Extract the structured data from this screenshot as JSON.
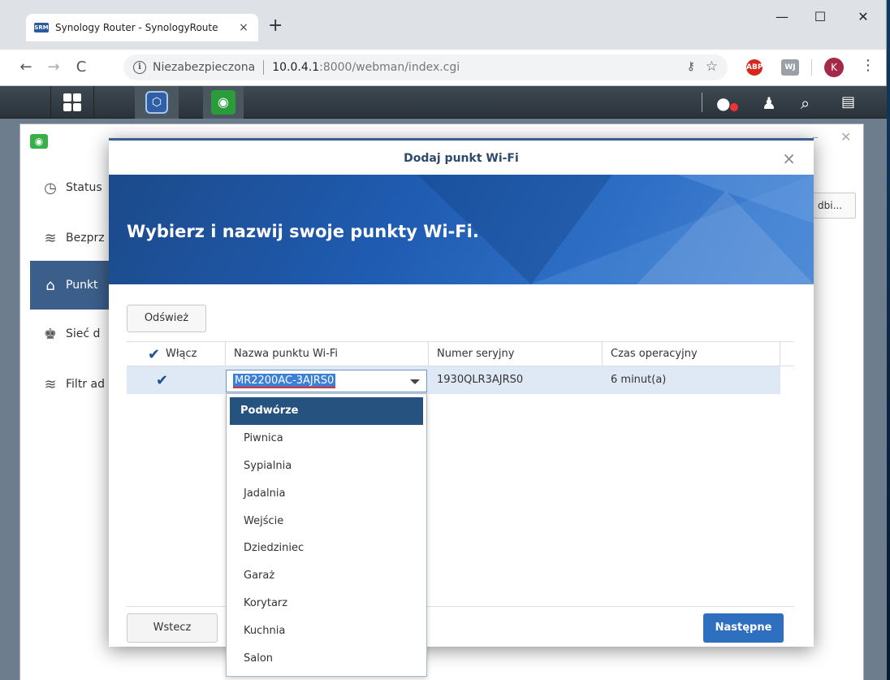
{
  "browser": {
    "tab_title": "Synology Router - SynologyRoute",
    "tab_favicon": "SRM",
    "tab_close": "×",
    "new_tab": "+",
    "window_minimize": "—",
    "window_maximize": "☐",
    "window_close": "✕",
    "back": "←",
    "forward": "→",
    "reload": "C",
    "security_label": "Niezabezpieczona",
    "url_host": "10.0.4.1",
    "url_path": ":8000/webman/index.cgi",
    "ext_abp": "ABP",
    "ext_wj": "WJ",
    "profile_initial": "K",
    "menu": "⋮",
    "icons": [
      "info-icon",
      "key-icon",
      "star-icon",
      "adblock-icon",
      "extension-icon",
      "profile-avatar",
      "menu-icon"
    ]
  },
  "dsm": {
    "taskbar_icons": [
      "main-menu-icon",
      "network-center-icon",
      "wifi-app-icon",
      "notifications-icon",
      "user-icon",
      "search-icon",
      "widgets-icon"
    ],
    "background_window": {
      "sidebar": [
        {
          "label": "Status",
          "icon": "gauge-icon"
        },
        {
          "label": "Bezprz",
          "icon": "wifi-icon"
        },
        {
          "label": "Punkt",
          "icon": "access-point-icon",
          "active": true
        },
        {
          "label": "Sieć d",
          "icon": "users-icon"
        },
        {
          "label": "Filtr ad",
          "icon": "wifi-filter-icon"
        }
      ],
      "partial_button": "dbi..."
    }
  },
  "dialog": {
    "title": "Dodaj punkt Wi-Fi",
    "close": "×",
    "heading": "Wybierz i nazwij swoje punkty Wi-Fi.",
    "refresh_label": "Odśwież",
    "columns": {
      "enable": "Włącz",
      "name": "Nazwa punktu Wi-Fi",
      "serial": "Numer seryjny",
      "uptime": "Czas operacyjny"
    },
    "rows": [
      {
        "enabled": true,
        "name": "MR2200AC-3AJRS0",
        "serial": "1930QLR3AJRS0",
        "uptime": "6 minut(a)"
      }
    ],
    "name_options": [
      "Podwórze",
      "Piwnica",
      "Sypialnia",
      "Jadalnia",
      "Wejście",
      "Dziedziniec",
      "Garaż",
      "Korytarz",
      "Kuchnia",
      "Salon"
    ],
    "highlighted_option": "Podwórze",
    "back_label": "Wstecz",
    "next_label": "Następne"
  }
}
